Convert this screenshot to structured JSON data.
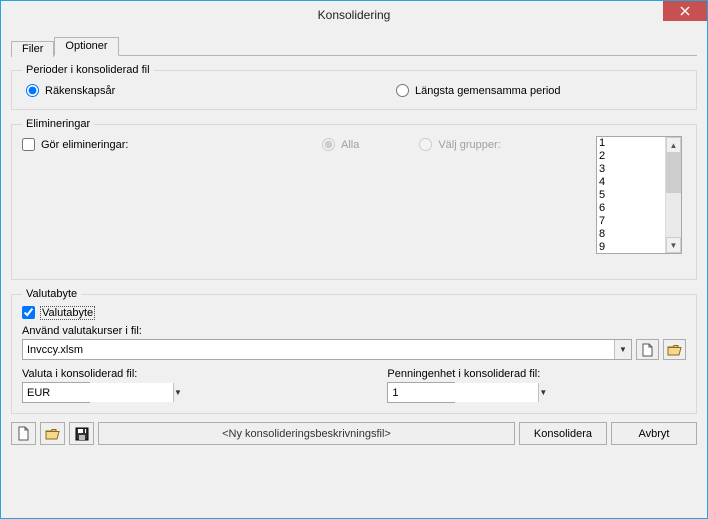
{
  "window": {
    "title": "Konsolidering"
  },
  "tabs": {
    "filer": "Filer",
    "optioner": "Optioner",
    "active": "optioner"
  },
  "periods": {
    "legend": "Perioder i konsoliderad fil",
    "rakenskapsar": "Räkenskapsår",
    "langsta": "Längsta gemensamma period"
  },
  "elim": {
    "legend": "Elimineringar",
    "gor": "Gör elimineringar:",
    "alla": "Alla",
    "valj": "Välj grupper:",
    "items": [
      "1",
      "2",
      "3",
      "4",
      "5",
      "6",
      "7",
      "8",
      "9"
    ]
  },
  "valuta": {
    "legend": "Valutabyte",
    "check": "Valutabyte",
    "anvand": "Använd valutakurser i fil:",
    "file": "Invccy.xlsm",
    "valuta_label": "Valuta i konsoliderad fil:",
    "valuta_value": "EUR",
    "penning_label": "Penningenhet i konsoliderad fil:",
    "penning_value": "1"
  },
  "bottom": {
    "path": "<Ny konsolideringsbeskrivningsfil>",
    "konsolidera": "Konsolidera",
    "avbryt": "Avbryt"
  }
}
